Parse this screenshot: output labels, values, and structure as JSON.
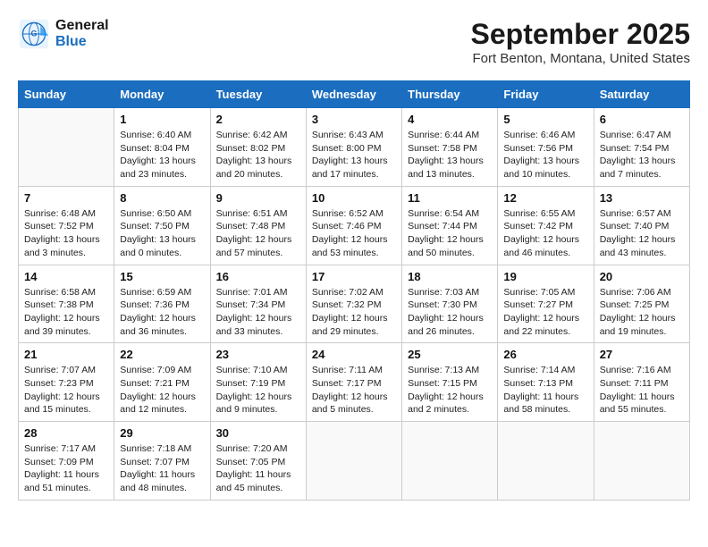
{
  "header": {
    "logo_line1": "General",
    "logo_line2": "Blue",
    "month": "September 2025",
    "location": "Fort Benton, Montana, United States"
  },
  "weekdays": [
    "Sunday",
    "Monday",
    "Tuesday",
    "Wednesday",
    "Thursday",
    "Friday",
    "Saturday"
  ],
  "weeks": [
    [
      {
        "day": "",
        "info": ""
      },
      {
        "day": "1",
        "info": "Sunrise: 6:40 AM\nSunset: 8:04 PM\nDaylight: 13 hours\nand 23 minutes."
      },
      {
        "day": "2",
        "info": "Sunrise: 6:42 AM\nSunset: 8:02 PM\nDaylight: 13 hours\nand 20 minutes."
      },
      {
        "day": "3",
        "info": "Sunrise: 6:43 AM\nSunset: 8:00 PM\nDaylight: 13 hours\nand 17 minutes."
      },
      {
        "day": "4",
        "info": "Sunrise: 6:44 AM\nSunset: 7:58 PM\nDaylight: 13 hours\nand 13 minutes."
      },
      {
        "day": "5",
        "info": "Sunrise: 6:46 AM\nSunset: 7:56 PM\nDaylight: 13 hours\nand 10 minutes."
      },
      {
        "day": "6",
        "info": "Sunrise: 6:47 AM\nSunset: 7:54 PM\nDaylight: 13 hours\nand 7 minutes."
      }
    ],
    [
      {
        "day": "7",
        "info": "Sunrise: 6:48 AM\nSunset: 7:52 PM\nDaylight: 13 hours\nand 3 minutes."
      },
      {
        "day": "8",
        "info": "Sunrise: 6:50 AM\nSunset: 7:50 PM\nDaylight: 13 hours\nand 0 minutes."
      },
      {
        "day": "9",
        "info": "Sunrise: 6:51 AM\nSunset: 7:48 PM\nDaylight: 12 hours\nand 57 minutes."
      },
      {
        "day": "10",
        "info": "Sunrise: 6:52 AM\nSunset: 7:46 PM\nDaylight: 12 hours\nand 53 minutes."
      },
      {
        "day": "11",
        "info": "Sunrise: 6:54 AM\nSunset: 7:44 PM\nDaylight: 12 hours\nand 50 minutes."
      },
      {
        "day": "12",
        "info": "Sunrise: 6:55 AM\nSunset: 7:42 PM\nDaylight: 12 hours\nand 46 minutes."
      },
      {
        "day": "13",
        "info": "Sunrise: 6:57 AM\nSunset: 7:40 PM\nDaylight: 12 hours\nand 43 minutes."
      }
    ],
    [
      {
        "day": "14",
        "info": "Sunrise: 6:58 AM\nSunset: 7:38 PM\nDaylight: 12 hours\nand 39 minutes."
      },
      {
        "day": "15",
        "info": "Sunrise: 6:59 AM\nSunset: 7:36 PM\nDaylight: 12 hours\nand 36 minutes."
      },
      {
        "day": "16",
        "info": "Sunrise: 7:01 AM\nSunset: 7:34 PM\nDaylight: 12 hours\nand 33 minutes."
      },
      {
        "day": "17",
        "info": "Sunrise: 7:02 AM\nSunset: 7:32 PM\nDaylight: 12 hours\nand 29 minutes."
      },
      {
        "day": "18",
        "info": "Sunrise: 7:03 AM\nSunset: 7:30 PM\nDaylight: 12 hours\nand 26 minutes."
      },
      {
        "day": "19",
        "info": "Sunrise: 7:05 AM\nSunset: 7:27 PM\nDaylight: 12 hours\nand 22 minutes."
      },
      {
        "day": "20",
        "info": "Sunrise: 7:06 AM\nSunset: 7:25 PM\nDaylight: 12 hours\nand 19 minutes."
      }
    ],
    [
      {
        "day": "21",
        "info": "Sunrise: 7:07 AM\nSunset: 7:23 PM\nDaylight: 12 hours\nand 15 minutes."
      },
      {
        "day": "22",
        "info": "Sunrise: 7:09 AM\nSunset: 7:21 PM\nDaylight: 12 hours\nand 12 minutes."
      },
      {
        "day": "23",
        "info": "Sunrise: 7:10 AM\nSunset: 7:19 PM\nDaylight: 12 hours\nand 9 minutes."
      },
      {
        "day": "24",
        "info": "Sunrise: 7:11 AM\nSunset: 7:17 PM\nDaylight: 12 hours\nand 5 minutes."
      },
      {
        "day": "25",
        "info": "Sunrise: 7:13 AM\nSunset: 7:15 PM\nDaylight: 12 hours\nand 2 minutes."
      },
      {
        "day": "26",
        "info": "Sunrise: 7:14 AM\nSunset: 7:13 PM\nDaylight: 11 hours\nand 58 minutes."
      },
      {
        "day": "27",
        "info": "Sunrise: 7:16 AM\nSunset: 7:11 PM\nDaylight: 11 hours\nand 55 minutes."
      }
    ],
    [
      {
        "day": "28",
        "info": "Sunrise: 7:17 AM\nSunset: 7:09 PM\nDaylight: 11 hours\nand 51 minutes."
      },
      {
        "day": "29",
        "info": "Sunrise: 7:18 AM\nSunset: 7:07 PM\nDaylight: 11 hours\nand 48 minutes."
      },
      {
        "day": "30",
        "info": "Sunrise: 7:20 AM\nSunset: 7:05 PM\nDaylight: 11 hours\nand 45 minutes."
      },
      {
        "day": "",
        "info": ""
      },
      {
        "day": "",
        "info": ""
      },
      {
        "day": "",
        "info": ""
      },
      {
        "day": "",
        "info": ""
      }
    ]
  ]
}
